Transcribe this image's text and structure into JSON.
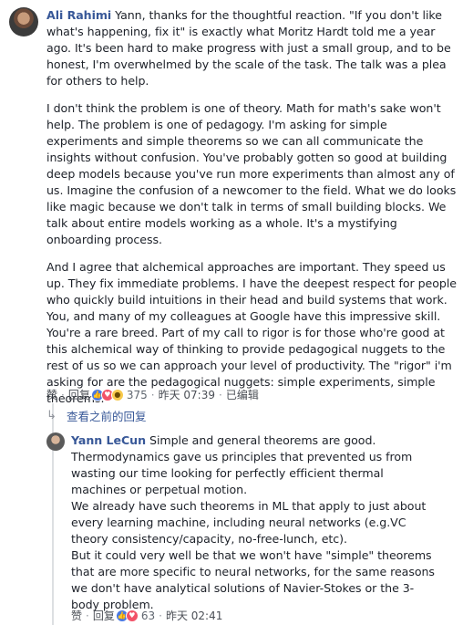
{
  "comment1": {
    "author": "Ali Rahimi",
    "paragraphs": [
      "Yann, thanks for the thoughtful reaction. \"If you don't like what's happening, fix it\" is exactly what Moritz Hardt told me a year ago. It's been hard to make progress with just a small group, and to be honest, I'm overwhelmed by the scale of the task. The talk was a plea for others to help.",
      "I don't think the problem is one of theory. Math for math's sake won't help. The problem is one of pedagogy. I'm asking for simple experiments and simple theorems so we can all communicate the insights without confusion. You've probably gotten so good at building deep models because you've run more experiments than almost any of us. Imagine the confusion of a newcomer to the field. What we do looks like magic because we don't talk in terms of small building blocks. We talk about entire models working as a whole. It's a mystifying onboarding process.",
      "And I agree that alchemical approaches are important. They speed us up. They fix immediate problems. I have the deepest respect for people who quickly build intuitions in their head and build systems that work. You, and many of my colleagues at Google have this impressive skill. You're a rare breed. Part of my call to rigor is for those who're good at this alchemical way of thinking to provide pedagogical nuggets to the rest of us so we can approach your level of productivity. The \"rigor\" i'm asking for are the pedagogical nuggets: simple experiments, simple theorems."
    ],
    "actions": {
      "like": "赞",
      "reply": "回复",
      "dot": "·",
      "reaction_count": "375",
      "time": "昨天 07:39",
      "edited": "已编辑"
    },
    "reactions": [
      "like-icon",
      "love-icon",
      "wow-icon"
    ]
  },
  "view_previous": "查看之前的回复",
  "comment2": {
    "author": "Yann LeCun",
    "text": "Simple and general theorems are good.\nThermodynamics gave us principles that prevented us from wasting our time looking for perfectly efficient thermal machines or perpetual motion.\nWe already have such theorems in ML that apply to just about every learning machine, including neural networks (e.g.VC theory consistency/capacity, no-free-lunch, etc).\nBut it could very well be that we won't have \"simple\" theorems that are more specific to neural networks, for the same reasons we don't have analytical solutions of Navier-Stokes or the 3-body problem.",
    "actions": {
      "like": "赞",
      "reply": "回复",
      "dot": "·",
      "reaction_count": "63",
      "time": "昨天 02:41"
    },
    "reactions": [
      "like-icon",
      "love-icon"
    ]
  }
}
